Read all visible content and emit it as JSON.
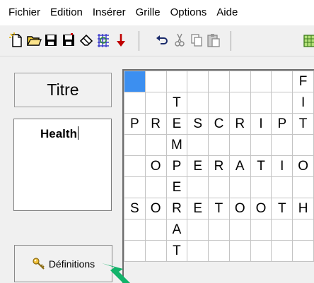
{
  "menu": [
    "Fichier",
    "Edition",
    "Insérer",
    "Grille",
    "Options",
    "Aide"
  ],
  "toolbar": [
    {
      "name": "new-document-icon"
    },
    {
      "name": "open-folder-icon"
    },
    {
      "name": "save-icon"
    },
    {
      "name": "save-as-icon"
    },
    {
      "name": "eraser-icon"
    },
    {
      "name": "grid-pattern-icon"
    },
    {
      "name": "down-arrow-icon"
    },
    {
      "name": "undo-icon"
    },
    {
      "name": "cut-icon"
    },
    {
      "name": "copy-icon"
    },
    {
      "name": "paste-icon"
    },
    {
      "name": "grid-generate-icon"
    }
  ],
  "title_button": "Titre",
  "word_input": "Health",
  "definitions_button": "Définitions",
  "grid": [
    [
      "",
      "",
      "",
      "",
      "",
      "",
      "",
      "",
      "F"
    ],
    [
      "",
      "",
      "T",
      "",
      "",
      "",
      "",
      "",
      "I"
    ],
    [
      "P",
      "R",
      "E",
      "S",
      "C",
      "R",
      "I",
      "P",
      "T"
    ],
    [
      "",
      "",
      "M",
      "",
      "",
      "",
      "",
      "",
      ""
    ],
    [
      "",
      "O",
      "P",
      "E",
      "R",
      "A",
      "T",
      "I",
      "O"
    ],
    [
      "",
      "",
      "E",
      "",
      "",
      "",
      "",
      "",
      ""
    ],
    [
      "S",
      "O",
      "R",
      "E",
      "T",
      "O",
      "O",
      "T",
      "H"
    ],
    [
      "",
      "",
      "A",
      "",
      "",
      "",
      "",
      "",
      ""
    ],
    [
      "",
      "",
      "T",
      "",
      "",
      "",
      "",
      "",
      ""
    ]
  ],
  "colors": {
    "selected_cell": "#3c8ff0",
    "arrow": "#12b36a"
  }
}
